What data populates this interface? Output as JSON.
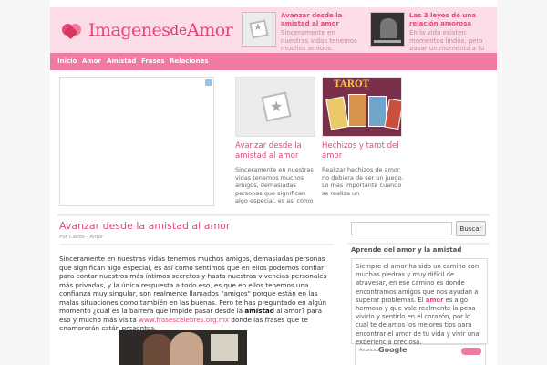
{
  "header": {
    "logo": {
      "part1": "Imagenes",
      "part2": "de",
      "part3": "Amor"
    },
    "posts": [
      {
        "title": "Avanzar desde la amistad al amor",
        "excerpt": "Sinceramente en nuestras vidas tenemos muchos amigos, demasiadas"
      },
      {
        "title": "Las 3 leyes de una relación amorosa",
        "excerpt": "En la vida existen momentos lindos, pero pasar un momento a tu lado para mí"
      }
    ]
  },
  "nav": {
    "items": [
      "Inicio",
      "Amor",
      "Amistad",
      "Frases",
      "Relaciones"
    ]
  },
  "featured": [
    {
      "title": "Avanzar desde la amistad al amor",
      "excerpt": "Sinceramente en nuestras vidas tenemos muchos amigos, demasiadas personas que significan algo especial, es así como sentimos"
    },
    {
      "title": "Hechizos y tarot del amor",
      "excerpt": "Realizar hechizos de amor no debiera de ser un juego. Lo más importante cuando se realiza un",
      "image_label": "TAROT"
    }
  ],
  "article": {
    "title": "Avanzar desde la amistad al amor",
    "meta": "Por Carlos - Amor",
    "body_1": "Sinceramente en nuestras vidas tenemos muchos amigos, demasiadas personas que significan algo especial, es así como sentimos que en ellos podemos confiar para contar nuestros más íntimos secretos y hasta nuestras vivencias personales más privadas, y la única respuesta a todo eso, es que en ellos tenemos una confianza muy singular, son realmente llamados \"amigos\" porque están en las malas situaciones como también en las buenas. Pero te has preguntado en algún momento ¿cual es la barrera que impide pasar desde la",
    "body_bold": "amistad",
    "body_2": "al amor? para eso y mucho más visita",
    "body_link": "www.frasescelebres.org.mx",
    "body_3": "donde las frases que te enamorarán están presentes."
  },
  "sidebar": {
    "search": {
      "value": "",
      "button": "Buscar"
    },
    "heading": "Aprende del amor y la amistad",
    "text_1": "Siempre el amor ha sido un camino con muchas piedras y muy difícil de atravesar, en ese camino es donde encontramos amigos que nos ayudan a superar problemas. El",
    "text_bold": "amor",
    "text_2": "es algo hermoso y que vale realmente la pena vivirlo y sentirlo en el corazón, por lo cual te dejamos los mejores tips para encontrar el amor de tu vida y vivir una experiencia preciosa.",
    "ad_label": "Anuncios",
    "ad_brand": "Google"
  },
  "colors": {
    "brand_pink": "#e24a79",
    "nav_pink": "#f07aa2",
    "header_bg": "#fcdce6"
  }
}
